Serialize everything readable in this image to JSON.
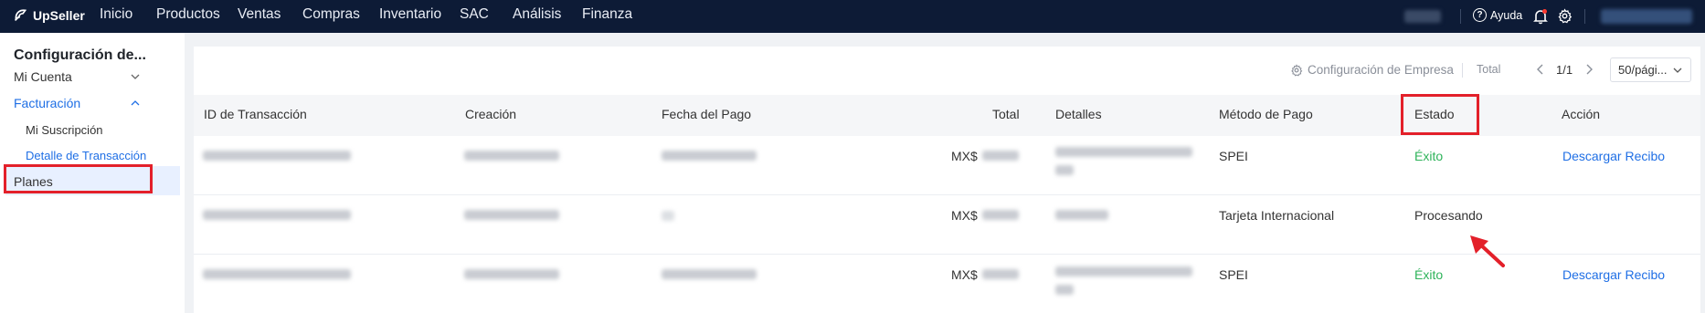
{
  "header": {
    "brand": "UpSeller",
    "nav": [
      "Inicio",
      "Productos",
      "Ventas",
      "Compras",
      "Inventario",
      "SAC",
      "Análisis",
      "Finanza"
    ],
    "help_label": "Ayuda"
  },
  "sidebar": {
    "title": "Configuración de...",
    "items": [
      {
        "label": "Mi Cuenta",
        "expanded": false
      },
      {
        "label": "Facturación",
        "expanded": true
      },
      {
        "label": "Planes"
      }
    ],
    "sub_items": [
      "Mi Suscripción",
      "Detalle de Transacción"
    ],
    "active": "Detalle de Transacción"
  },
  "toolbar": {
    "config_label": "Configuración de Empresa",
    "total_label": "Total",
    "page": "1/1",
    "page_size": "50/pági..."
  },
  "table": {
    "columns": [
      "ID de Transacción",
      "Creación",
      "Fecha del Pago",
      "Total",
      "Detalles",
      "Método de Pago",
      "Estado",
      "Acción"
    ],
    "rows": [
      {
        "currency": "MX$",
        "method": "SPEI",
        "status": "Éxito",
        "action": "Descargar Recibo"
      },
      {
        "currency": "MX$",
        "method": "Tarjeta Internacional",
        "status": "Procesando",
        "action": ""
      },
      {
        "currency": "MX$",
        "method": "SPEI",
        "status": "Éxito",
        "action": "Descargar Recibo"
      }
    ]
  },
  "colors": {
    "topbar": "#0d1b36",
    "accent": "#1f6fe5",
    "success": "#2eb35a",
    "highlight": "#e3202a"
  }
}
